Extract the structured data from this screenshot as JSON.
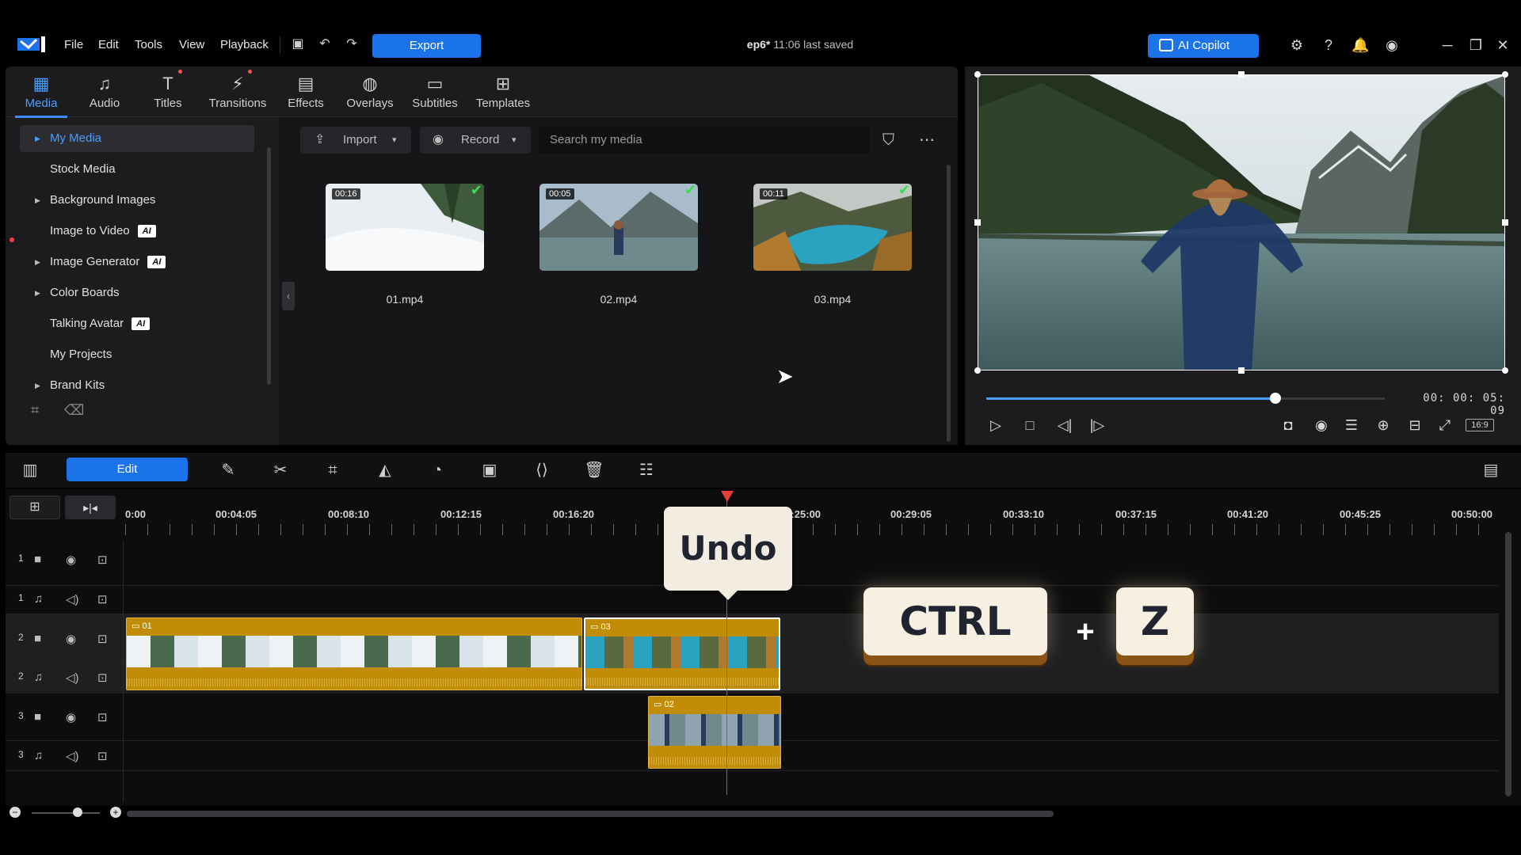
{
  "app": {
    "menu": [
      "File",
      "Edit",
      "Tools",
      "View",
      "Playback"
    ],
    "export_label": "Export",
    "project_name": "ep6*",
    "saved_status": "11:06 last saved",
    "ai_copilot_label": "AI Copilot",
    "accent_color": "#1a73e8"
  },
  "tabs": [
    {
      "label": "Media",
      "icon": "media-icon"
    },
    {
      "label": "Audio",
      "icon": "music-note-icon"
    },
    {
      "label": "Titles",
      "icon": "titles-icon"
    },
    {
      "label": "Transitions",
      "icon": "transitions-icon"
    },
    {
      "label": "Effects",
      "icon": "effects-icon"
    },
    {
      "label": "Overlays",
      "icon": "overlays-icon"
    },
    {
      "label": "Subtitles",
      "icon": "subtitles-icon"
    },
    {
      "label": "Templates",
      "icon": "templates-icon"
    }
  ],
  "sidebar": {
    "items": [
      {
        "label": "My Media",
        "arrow": true,
        "selected": true
      },
      {
        "label": "Stock Media"
      },
      {
        "label": "Background Images",
        "arrow": true
      },
      {
        "label": "Image to Video",
        "badge": "AI",
        "dot": true
      },
      {
        "label": "Image Generator",
        "arrow": true,
        "badge": "AI"
      },
      {
        "label": "Color Boards",
        "arrow": true
      },
      {
        "label": "Talking Avatar",
        "badge": "AI"
      },
      {
        "label": "My Projects"
      },
      {
        "label": "Brand Kits",
        "arrow": true
      }
    ]
  },
  "media": {
    "import_label": "Import",
    "record_label": "Record",
    "search_placeholder": "Search my media",
    "items": [
      {
        "name": "01.mp4",
        "duration": "00:16"
      },
      {
        "name": "02.mp4",
        "duration": "00:05"
      },
      {
        "name": "03.mp4",
        "duration": "00:11"
      }
    ]
  },
  "preview": {
    "timecode": "00: 00: 05: 09",
    "progress": 0.725,
    "aspect": "16:9"
  },
  "toolbar": {
    "edit_label": "Edit"
  },
  "timeline": {
    "ruler": [
      "0:00",
      "00:04:05",
      "00:08:10",
      "00:12:15",
      "00:16:20",
      "00:25:00",
      "00:29:05",
      "00:33:10",
      "00:37:15",
      "00:41:20",
      "00:45:25",
      "00:50:00"
    ],
    "tracks": [
      {
        "num": "1",
        "type": "video"
      },
      {
        "num": "1",
        "type": "audio"
      },
      {
        "num": "2",
        "type": "video"
      },
      {
        "num": "2",
        "type": "audio"
      },
      {
        "num": "3",
        "type": "video"
      },
      {
        "num": "3",
        "type": "audio"
      }
    ],
    "clips": {
      "a": "01",
      "b": "03",
      "c": "02"
    }
  },
  "overlay": {
    "undo": "Undo",
    "key1": "CTRL",
    "plus": "+",
    "key2": "Z"
  }
}
